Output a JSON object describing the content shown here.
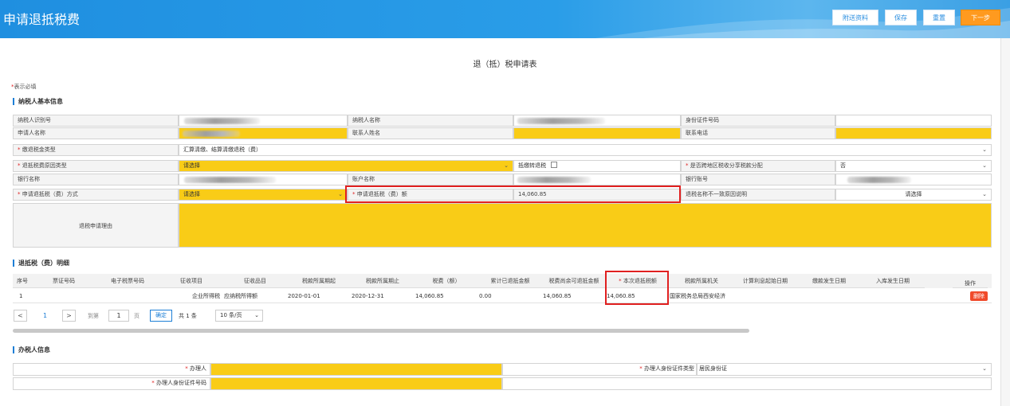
{
  "header": {
    "title": "申请退抵税费",
    "buttons": {
      "attach": "附送资料",
      "save": "保存",
      "reset": "重置",
      "next": "下一步"
    }
  },
  "page_heading": "退（抵）税申请表",
  "required_note": {
    "star": "*",
    "text": "表示必填"
  },
  "sections": {
    "basic": "纳税人基本信息",
    "detail": "退抵税（费）明细",
    "agent": "办税人信息"
  },
  "basic": {
    "taxpayer_id": "纳税人识别号",
    "taxpayer_name": "纳税人名称",
    "id_number": "身份证件号码",
    "applicant_name": "申请人名称",
    "contact_name": "联系人姓名",
    "contact_phone": "联系电话",
    "payment_type_label": "缴退税金类型",
    "payment_type_value": "汇算清缴、结算清缴退税（费）",
    "reason_type_label": "退抵税费原因类型",
    "reason_type_value": "请选择",
    "offset_label": "抵缴转退税",
    "cross_region_label": "是否跨地区税收分享税款分配",
    "cross_region_value": "否",
    "bank_name": "银行名称",
    "account_name": "账户名称",
    "bank_account": "银行账号",
    "method_label": "申请退抵税（费）方式",
    "method_value": "请选择",
    "amount_label": "申请退抵税（费）额",
    "amount_value": "14,060.85",
    "mismatch_label": "退税名称不一致原因说明",
    "mismatch_value": "请选择",
    "reason_label": "退税申请理由"
  },
  "detail_table": {
    "headers": [
      "序号",
      "票证号码",
      "电子税票号码",
      "征收项目",
      "征收品目",
      "税款所属期起",
      "税款所属期止",
      "税费（额）",
      "累计已退抵金额",
      "税费尚余可退抵金额",
      "本次退抵税额",
      "税款所属机关",
      "计算利息起始日期",
      "缴款发生日期",
      "入库发生日期",
      "操作"
    ],
    "row": {
      "index": "1",
      "ticket_no": "",
      "e_ticket_no": "",
      "item": "企业所得税",
      "sub_item": "应纳税所得额",
      "period_start": "2020-01-01",
      "period_end": "2020-12-31",
      "tax_amount": "14,060.85",
      "refunded": "0.00",
      "remaining": "14,060.85",
      "current_refund": "14,060.85",
      "authority": "国家税务总局西安经济",
      "delete": "删除"
    }
  },
  "pager": {
    "prev": "<",
    "page": "1",
    "next": ">",
    "goto_prefix": "到第",
    "goto_value": "1",
    "goto_suffix": "页",
    "confirm": "确定",
    "total": "共 1 条",
    "page_size": "10 条/页"
  },
  "agent": {
    "handler_label": "办理人",
    "id_type_label": "办理人身份证件类型",
    "id_type_value": "居民身份证",
    "id_number_label": "办理人身份证件号码"
  },
  "colors": {
    "header_blue": "#2a9de8",
    "highlight_yellow": "#f9cc17",
    "required_red": "#e02020",
    "next_orange": "#ff9a1f"
  }
}
